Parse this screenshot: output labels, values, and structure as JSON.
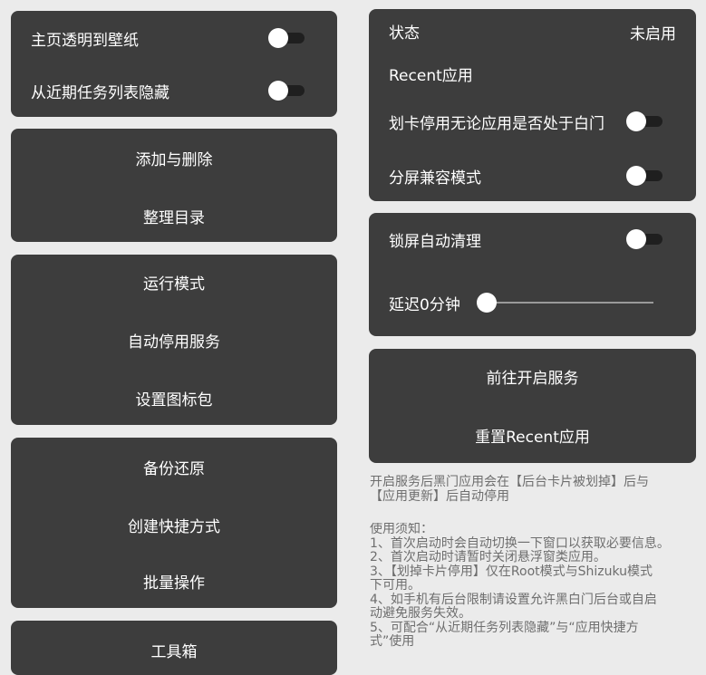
{
  "left": {
    "card1": {
      "home_transparent": "主页透明到壁纸",
      "hide_recents": "从近期任务列表隐藏"
    },
    "card2": {
      "add_remove": "添加与删除",
      "organize": "整理目录"
    },
    "card3": {
      "run_mode": "运行模式",
      "auto_disable": "自动停用服务",
      "icon_pack": "设置图标包"
    },
    "card4": {
      "backup": "备份还原",
      "shortcut": "创建快捷方式",
      "batch": "批量操作"
    },
    "card5": {
      "toolbox": "工具箱"
    }
  },
  "right": {
    "status_card": {
      "status_label": "状态",
      "status_value": "未启用",
      "recent_apps": "Recent应用",
      "swipe_disable": "划卡停用无论应用是否处于白门",
      "split_screen": "分屏兼容模式"
    },
    "lock_card": {
      "lock_clean": "锁屏自动清理",
      "delay": "延迟0分钟"
    },
    "service_card": {
      "start_service": "前往开启服务",
      "reset_recent": "重置Recent应用"
    },
    "note1": "开启服务后黑门应用会在【后台卡片被划掉】后与\n【应用更新】后自动停用",
    "note2": "使用须知：\n1、首次启动时会自动切换一下窗口以获取必要信息。\n2、首次启动时请暂时关闭悬浮窗类应用。\n3、【划掉卡片停用】仅在Root模式与Shizuku模式\n下可用。\n4、如手机有后台限制请设置允许黑白门后台或自启\n动避免服务失效。\n5、可配合“从近期任务列表隐藏”与“应用快捷方\n式”使用"
  },
  "toggles": {
    "home_transparent": false,
    "hide_recents": false,
    "swipe_disable": false,
    "split_screen": false,
    "lock_clean": false
  },
  "delay_minutes": 0,
  "colors": {
    "background": "#ebebeb",
    "card": "#3d3d3d",
    "text": "#ffffff",
    "note": "#6e6e6e"
  }
}
